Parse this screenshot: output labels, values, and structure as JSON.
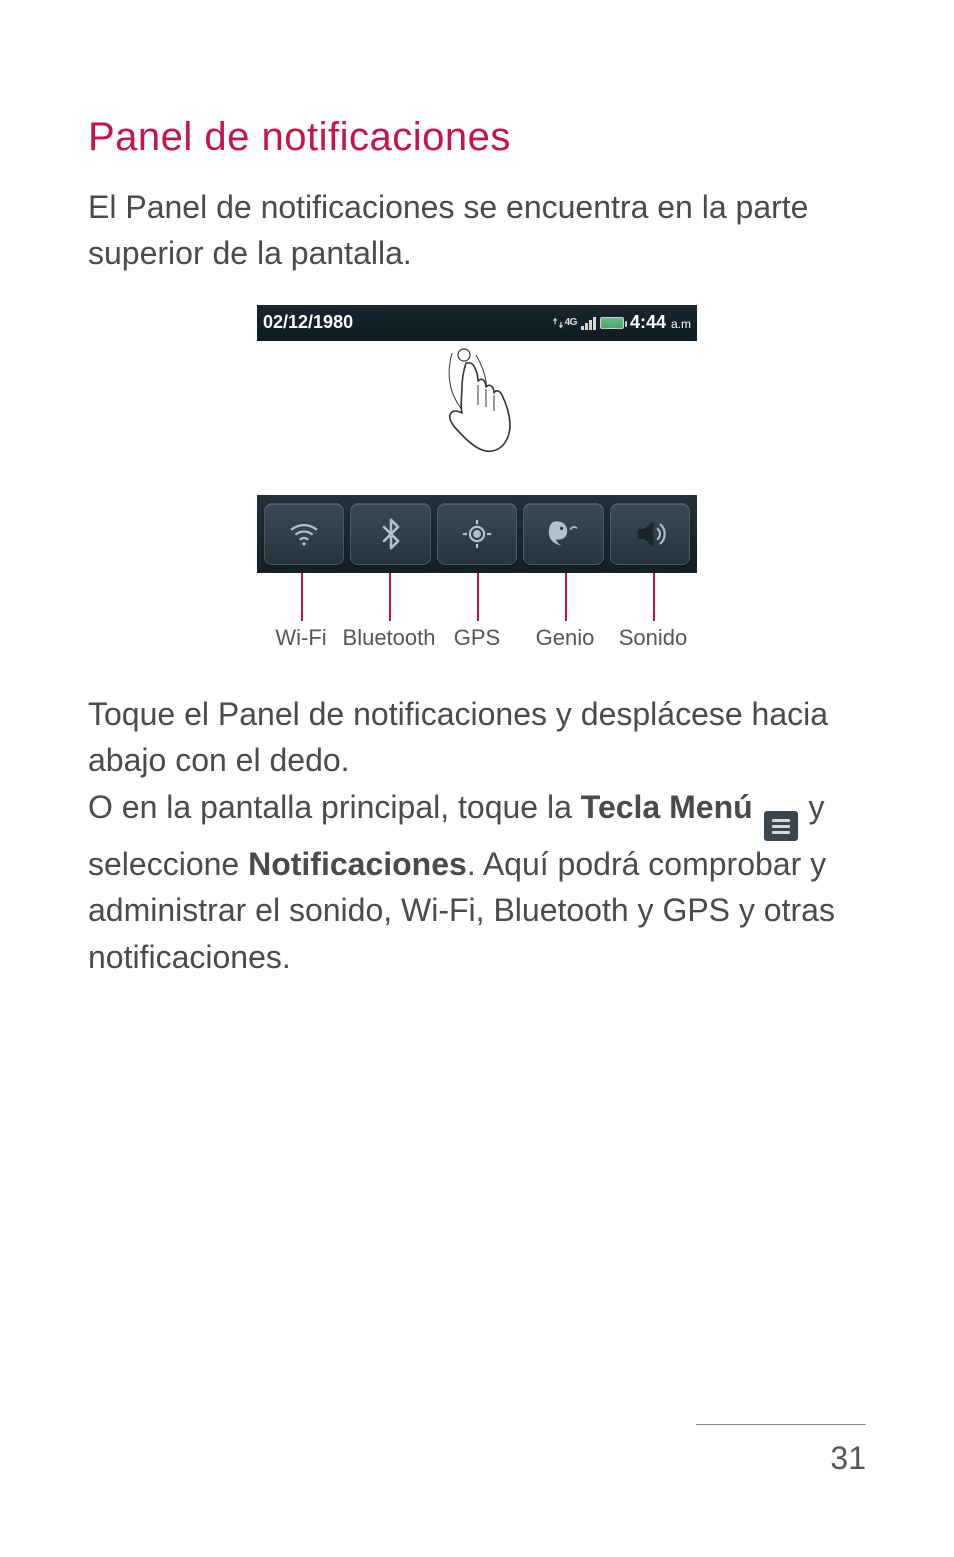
{
  "heading": "Panel de notificaciones",
  "intro": "El Panel de notificaciones se encuentra en la parte superior de la pantalla.",
  "statusbar": {
    "date": "02/12/1980",
    "network_label": "4G",
    "time": "4:44",
    "ampm": "a.m"
  },
  "quick_settings": [
    {
      "id": "wifi",
      "label": "Wi-Fi"
    },
    {
      "id": "bt",
      "label": "Bluetooth"
    },
    {
      "id": "gps",
      "label": "GPS"
    },
    {
      "id": "genio",
      "label": "Genio"
    },
    {
      "id": "sound",
      "label": "Sonido"
    }
  ],
  "para2": {
    "l1": "Toque el Panel de notificaciones y desplácese hacia abajo con el dedo.",
    "l2a": "O en la pantalla principal, toque la ",
    "kw_menu": "Tecla Menú",
    "l2b": " y seleccione ",
    "kw_notif": "Notificaciones",
    "l2c": ". Aquí podrá comprobar y administrar el sonido, Wi-Fi, Bluetooth y GPS y otras notificaciones."
  },
  "page_number": "31"
}
